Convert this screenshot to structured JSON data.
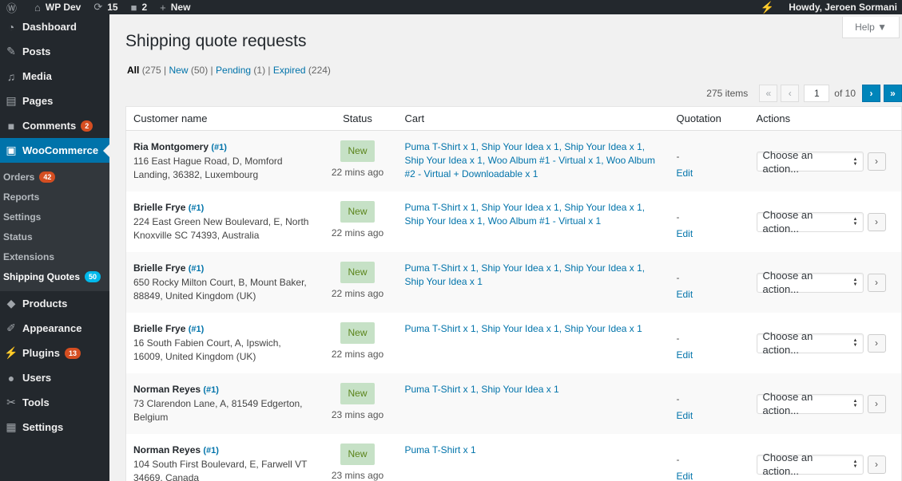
{
  "adminbar": {
    "site_name": "WP Dev",
    "updates_count": "15",
    "comments_count": "2",
    "new_label": "New",
    "howdy": "Howdy, Jeroen Sormani"
  },
  "sidebar": {
    "items": [
      {
        "label": "Dashboard",
        "icon": "dashboard-icon"
      },
      {
        "label": "Posts",
        "icon": "pin-icon"
      },
      {
        "label": "Media",
        "icon": "media-icon"
      },
      {
        "label": "Pages",
        "icon": "pages-icon"
      },
      {
        "label": "Comments",
        "icon": "comment-icon",
        "count": "2"
      },
      {
        "label": "WooCommerce",
        "icon": "woo-icon"
      }
    ],
    "submenu": [
      {
        "label": "Orders",
        "count": "42"
      },
      {
        "label": "Reports"
      },
      {
        "label": "Settings"
      },
      {
        "label": "Status"
      },
      {
        "label": "Extensions"
      },
      {
        "label": "Shipping Quotes",
        "count": "50"
      }
    ],
    "items_after": [
      {
        "label": "Products",
        "icon": "products-icon"
      },
      {
        "label": "Appearance",
        "icon": "brush-icon"
      },
      {
        "label": "Plugins",
        "icon": "plugin-icon",
        "count": "13"
      },
      {
        "label": "Users",
        "icon": "users-icon"
      },
      {
        "label": "Tools",
        "icon": "tools-icon"
      },
      {
        "label": "Settings",
        "icon": "settings-icon"
      }
    ]
  },
  "help_label": "Help ▼",
  "page_title": "Shipping quote requests",
  "views": {
    "all": "All",
    "all_count": "(275",
    "new": "New",
    "new_count": "(50)",
    "pending": "Pending",
    "pending_count": "(1)",
    "expired": "Expired",
    "expired_count": "(224)"
  },
  "pagination": {
    "items": "275 items",
    "first": "«",
    "prev": "‹",
    "current": "1",
    "of": "of 10",
    "next": "›",
    "last": "»"
  },
  "table": {
    "headers": [
      "Customer name",
      "Status",
      "Cart",
      "Quotation",
      "Actions"
    ],
    "rows": [
      {
        "name": "Ria Montgomery",
        "id": "(#1)",
        "address": "116 East Hague Road, D, Momford Landing, 36382, Luxembourg",
        "status": "New",
        "time": "22 mins ago",
        "cart": "Puma T-Shirt x 1, Ship Your Idea x 1, Ship Your Idea x 1, Ship Your Idea x 1, Woo Album #1 - Virtual x 1, Woo Album #2 - Virtual + Downloadable x 1",
        "quote": "-",
        "edit": "Edit",
        "action": "Choose an action...",
        "go": "›"
      },
      {
        "name": "Brielle Frye",
        "id": "(#1)",
        "address": "224 East Green New Boulevard, E, North Knoxville SC 74393, Australia",
        "status": "New",
        "time": "22 mins ago",
        "cart": "Puma T-Shirt x 1, Ship Your Idea x 1, Ship Your Idea x 1, Ship Your Idea x 1, Woo Album #1 - Virtual x 1",
        "quote": "-",
        "edit": "Edit",
        "action": "Choose an action...",
        "go": "›"
      },
      {
        "name": "Brielle Frye",
        "id": "(#1)",
        "address": "650 Rocky Milton Court, B, Mount Baker, 88849, United Kingdom (UK)",
        "status": "New",
        "time": "22 mins ago",
        "cart": "Puma T-Shirt x 1, Ship Your Idea x 1, Ship Your Idea x 1, Ship Your Idea x 1",
        "quote": "-",
        "edit": "Edit",
        "action": "Choose an action...",
        "go": "›"
      },
      {
        "name": "Brielle Frye",
        "id": "(#1)",
        "address": "16 South Fabien Court, A, Ipswich, 16009, United Kingdom (UK)",
        "status": "New",
        "time": "22 mins ago",
        "cart": "Puma T-Shirt x 1, Ship Your Idea x 1, Ship Your Idea x 1",
        "quote": "-",
        "edit": "Edit",
        "action": "Choose an action...",
        "go": "›"
      },
      {
        "name": "Norman Reyes",
        "id": "(#1)",
        "address": "73 Clarendon Lane, A, 81549 Edgerton, Belgium",
        "status": "New",
        "time": "23 mins ago",
        "cart": "Puma T-Shirt x 1, Ship Your Idea x 1",
        "quote": "-",
        "edit": "Edit",
        "action": "Choose an action...",
        "go": "›"
      },
      {
        "name": "Norman Reyes",
        "id": "(#1)",
        "address": "104 South First Boulevard, E, Farwell VT 34669, Canada",
        "status": "New",
        "time": "23 mins ago",
        "cart": "Puma T-Shirt x 1",
        "quote": "-",
        "edit": "Edit",
        "action": "Choose an action...",
        "go": "›"
      }
    ]
  },
  "colors": {
    "adminbar_bg": "#23282d",
    "accent": "#0073aa",
    "status_new_bg": "#c6e1c6",
    "status_new_text": "#5b841b",
    "badge_red": "#d54e21"
  }
}
